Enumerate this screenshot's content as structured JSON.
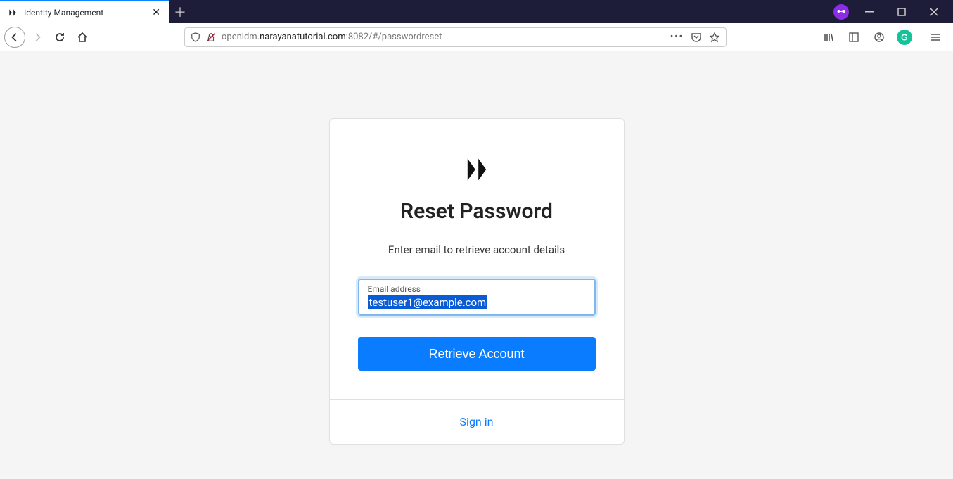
{
  "browser": {
    "tab_title": "Identity Management",
    "url_prefix": "openidm.",
    "url_domain": "narayanatutorial.com",
    "url_suffix": ":8082/#/passwordreset"
  },
  "page": {
    "heading": "Reset Password",
    "subtitle": "Enter email to retrieve account details",
    "email_label": "Email address",
    "email_value": "testuser1@example.com",
    "button_label": "Retrieve Account",
    "signin_link": "Sign in"
  }
}
